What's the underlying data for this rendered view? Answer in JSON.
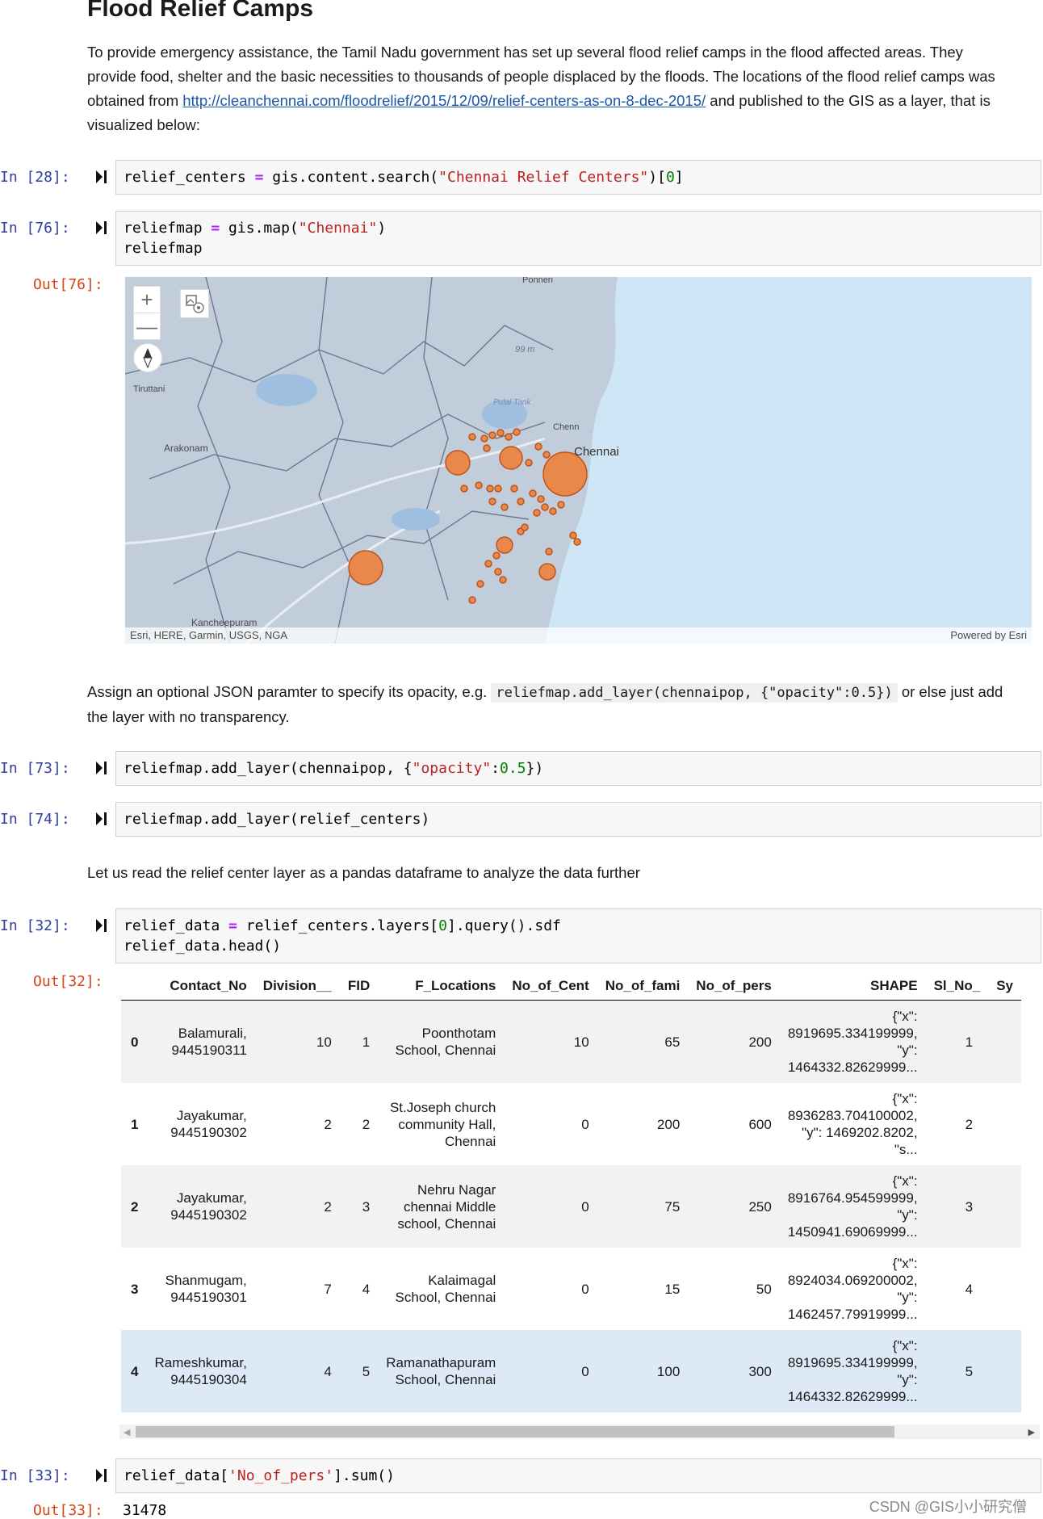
{
  "section": {
    "title": "Flood Relief Camps",
    "intro_text": "To provide emergency assistance, the Tamil Nadu government has set up several flood relief camps in the flood affected areas. They provide food, shelter and the basic necessities to thousands of people displaced by the floods. The locations of the flood relief camps was obtained from ",
    "intro_link": "http://cleanchennai.com/floodrelief/2015/12/09/relief-centers-as-on-8-dec-2015/",
    "intro_tail": " and published to the GIS as a layer, that is visualized below:"
  },
  "cells": [
    {
      "prompt": "In [28]:",
      "code": "relief_centers = gis.content.search(\"Chennai Relief Centers\")[0]"
    },
    {
      "prompt": "In [76]:",
      "code": "reliefmap = gis.map(\"Chennai\")\nreliefmap",
      "out_prompt": "Out[76]:"
    },
    {
      "prompt": "In [73]:",
      "code": "reliefmap.add_layer(chennaipop, {\"opacity\":0.5})"
    },
    {
      "prompt": "In [74]:",
      "code": "reliefmap.add_layer(relief_centers)"
    },
    {
      "prompt": "In [32]:",
      "code": "relief_data = relief_centers.layers[0].query().sdf\nrelief_data.head()",
      "out_prompt": "Out[32]:"
    },
    {
      "prompt": "In [33]:",
      "code": "relief_data['No_of_pers'].sum()",
      "out_prompt": "Out[33]:",
      "output": "31478"
    }
  ],
  "opacity_note": {
    "before": "Assign an optional JSON paramter to specify its opacity, e.g. ",
    "code": "reliefmap.add_layer(chennaipop, {\"opacity\":0.5})",
    "after": " or else just add the layer with no transparency."
  },
  "dataframe_note": "Let us read the relief center layer as a pandas dataframe to analyze the data further",
  "map": {
    "attribution": "Esri, HERE, Garmin, USGS, NGA",
    "powered_by": "Powered by Esri",
    "labels": {
      "chennai": "Chennai",
      "ponneri": "Ponneri",
      "arakonam": "Arakonam",
      "kancheepuram": "Kancheepuram",
      "tiruttani": "Tiruttani",
      "puzhal": "Pulal Tank",
      "elevation": "99 m",
      "chennai_short": "Chenn"
    },
    "controls": {
      "zoom_in": "+",
      "zoom_out": "—"
    },
    "colors": {
      "land": "#c4cfdd",
      "water": "#cfe6f6",
      "point": "#e8884a",
      "boundary": "#4a5568"
    }
  },
  "table": {
    "columns": [
      "",
      "Contact_No",
      "Division__",
      "FID",
      "F_Locations",
      "No_of_Cent",
      "No_of_fami",
      "No_of_pers",
      "SHAPE",
      "Sl_No_",
      "Sy"
    ],
    "rows": [
      {
        "idx": "0",
        "contact_1": "Balamurali,",
        "contact_2": "9445190311",
        "division": "10",
        "fid": "1",
        "loc_1": "Poonthotam",
        "loc_2": "School, Chennai",
        "loc_3": "",
        "cent": "10",
        "fami": "65",
        "pers": "200",
        "shape_1": "{\"x\":",
        "shape_2": "8919695.334199999,",
        "shape_3": "\"y\":",
        "shape_4": "1464332.82629999...",
        "sl": "1"
      },
      {
        "idx": "1",
        "contact_1": "Jayakumar,",
        "contact_2": "9445190302",
        "division": "2",
        "fid": "2",
        "loc_1": "St.Joseph church",
        "loc_2": "community Hall,",
        "loc_3": "Chennai",
        "cent": "0",
        "fami": "200",
        "pers": "600",
        "shape_1": "{\"x\":",
        "shape_2": "8936283.704100002,",
        "shape_3": "\"y\": 1469202.8202,",
        "shape_4": "\"s...",
        "sl": "2"
      },
      {
        "idx": "2",
        "contact_1": "Jayakumar,",
        "contact_2": "9445190302",
        "division": "2",
        "fid": "3",
        "loc_1": "Nehru Nagar",
        "loc_2": "chennai Middle",
        "loc_3": "school, Chennai",
        "cent": "0",
        "fami": "75",
        "pers": "250",
        "shape_1": "{\"x\":",
        "shape_2": "8916764.954599999,",
        "shape_3": "\"y\":",
        "shape_4": "1450941.69069999...",
        "sl": "3"
      },
      {
        "idx": "3",
        "contact_1": "Shanmugam,",
        "contact_2": "9445190301",
        "division": "7",
        "fid": "4",
        "loc_1": "Kalaimagal",
        "loc_2": "School, Chennai",
        "loc_3": "",
        "cent": "0",
        "fami": "15",
        "pers": "50",
        "shape_1": "{\"x\":",
        "shape_2": "8924034.069200002,",
        "shape_3": "\"y\":",
        "shape_4": "1462457.79919999...",
        "sl": "4"
      },
      {
        "idx": "4",
        "contact_1": "Rameshkumar,",
        "contact_2": "9445190304",
        "division": "4",
        "fid": "5",
        "loc_1": "Ramanathapuram",
        "loc_2": "School, Chennai",
        "loc_3": "",
        "cent": "0",
        "fami": "100",
        "pers": "300",
        "shape_1": "{\"x\":",
        "shape_2": "8919695.334199999,",
        "shape_3": "\"y\":",
        "shape_4": "1464332.82629999...",
        "sl": "5"
      }
    ]
  },
  "watermark": "CSDN @GIS小小研究僧"
}
